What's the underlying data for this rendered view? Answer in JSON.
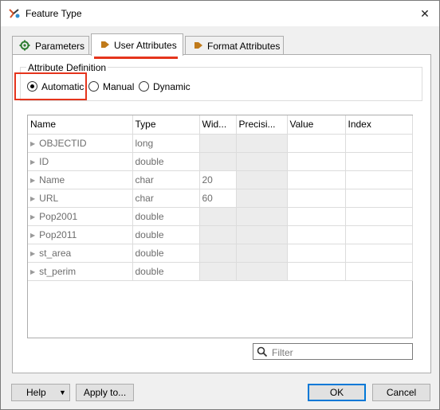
{
  "window": {
    "title": "Feature Type"
  },
  "tabs": [
    {
      "label": "Parameters"
    },
    {
      "label": "User Attributes"
    },
    {
      "label": "Format Attributes"
    }
  ],
  "attribute_definition": {
    "legend": "Attribute Definition",
    "options": [
      "Automatic",
      "Manual",
      "Dynamic"
    ],
    "selected": "Automatic"
  },
  "table": {
    "columns": [
      "Name",
      "Type",
      "Wid...",
      "Precisi...",
      "Value",
      "Index"
    ],
    "rows": [
      {
        "name": "OBJECTID",
        "type": "long",
        "width": "",
        "precision": "",
        "value": "",
        "index": ""
      },
      {
        "name": "ID",
        "type": "double",
        "width": "",
        "precision": "",
        "value": "",
        "index": ""
      },
      {
        "name": "Name",
        "type": "char",
        "width": "20",
        "precision": "",
        "value": "",
        "index": ""
      },
      {
        "name": "URL",
        "type": "char",
        "width": "60",
        "precision": "",
        "value": "",
        "index": ""
      },
      {
        "name": "Pop2001",
        "type": "double",
        "width": "",
        "precision": "",
        "value": "",
        "index": ""
      },
      {
        "name": "Pop2011",
        "type": "double",
        "width": "",
        "precision": "",
        "value": "",
        "index": ""
      },
      {
        "name": "st_area",
        "type": "double",
        "width": "",
        "precision": "",
        "value": "",
        "index": ""
      },
      {
        "name": "st_perim",
        "type": "double",
        "width": "",
        "precision": "",
        "value": "",
        "index": ""
      }
    ]
  },
  "filter": {
    "placeholder": "Filter"
  },
  "buttons": {
    "help": "Help",
    "apply": "Apply to...",
    "ok": "OK",
    "cancel": "Cancel"
  },
  "colors": {
    "highlight": "#e5341c",
    "tab_icon": "#c07a1a",
    "gear_icon": "#2e7d32"
  },
  "icons": {
    "app": "fme-icon",
    "close": "close-icon",
    "parameters": "gear-icon",
    "user": "arrow-right-icon",
    "format": "arrow-right-icon",
    "filter": "search-icon",
    "help_menu": "caret-down-icon"
  }
}
